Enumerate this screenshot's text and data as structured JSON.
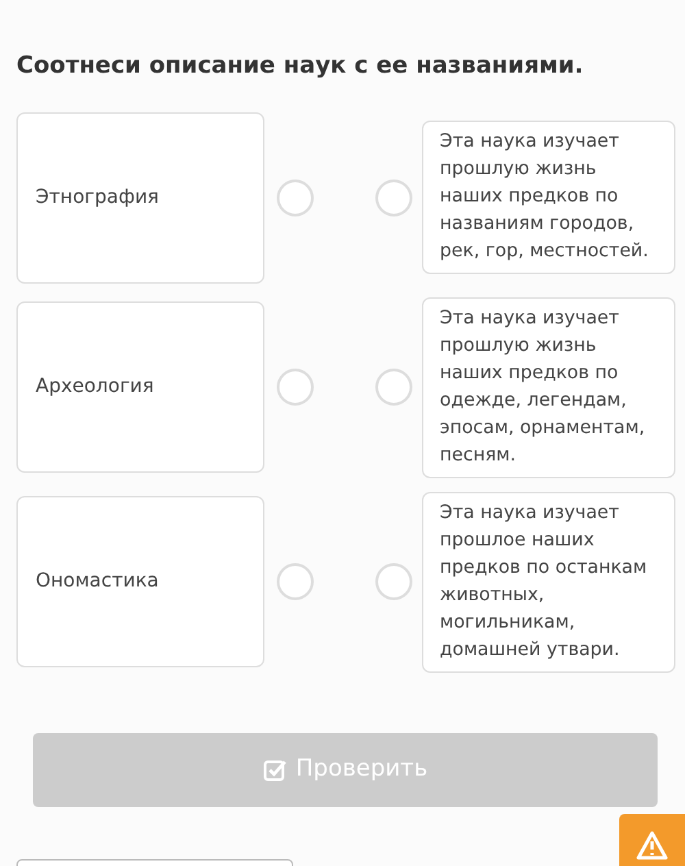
{
  "title": "Соотнеси описание наук с ее названиями.",
  "pairs": [
    {
      "term": "Этнография",
      "term_radio": {
        "selected": false
      },
      "description_radio": {
        "selected": false
      },
      "description": [
        "Эта наука изучает",
        "прошлую жизнь",
        "наших предков по",
        "названиям городов,",
        "рек, гор, местностей."
      ]
    },
    {
      "term": "Археология",
      "term_radio": {
        "selected": false
      },
      "description_radio": {
        "selected": false
      },
      "description": [
        "Эта наука изучает",
        "прошлую жизнь",
        "наших предков по",
        "одежде, легендам,",
        "эпосам, орнаментам,",
        "песням."
      ]
    },
    {
      "term": "Ономастика",
      "term_radio": {
        "selected": false
      },
      "description_radio": {
        "selected": false
      },
      "description": [
        "Эта наука изучает",
        "прошлое наших",
        "предков по останкам",
        "животных,",
        "могильникам,",
        "домашней утвари."
      ]
    }
  ],
  "check_button": {
    "label": "Проверить",
    "disabled": true
  }
}
